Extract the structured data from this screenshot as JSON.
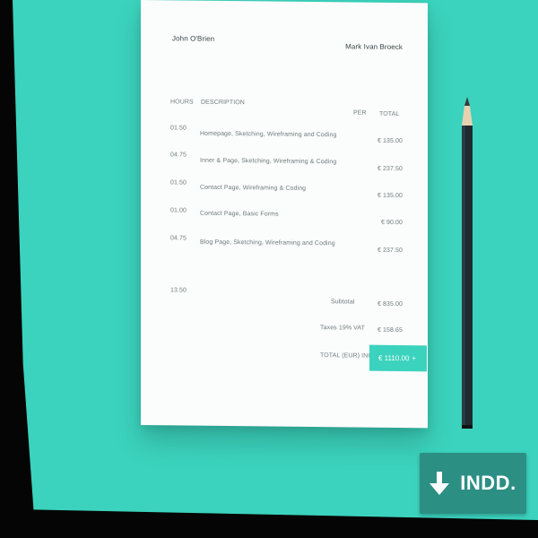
{
  "invoice": {
    "client_name": "John O'Brien",
    "sender_name": "Mark Ivan Broeck",
    "header": {
      "hours": "HOURS",
      "description": "DESCRIPTION",
      "per": "PER",
      "total": "TOTAL"
    },
    "lines": [
      {
        "hours": "01.50",
        "description": "Homepage, Sketching, Wireframing and Coding",
        "amount": "€ 135.00"
      },
      {
        "hours": "04.75",
        "description": "Inner & Page, Sketching, Wireframing & Coding",
        "amount": "€ 237.50"
      },
      {
        "hours": "01.50",
        "description": "Contact Page, Wireframing & Coding",
        "amount": "€ 135.00"
      },
      {
        "hours": "01.00",
        "description": "Contact Page, Basic Forms",
        "amount": "€ 90.00"
      },
      {
        "hours": "04.75",
        "description": "Blog Page, Sketching, Wireframing and Coding",
        "amount": "€ 237.50"
      }
    ],
    "total_hours": "13.50",
    "subtotal_label": "Subtotal",
    "subtotal_value": "€ 835.00",
    "tax_label": "Taxes 19% VAT",
    "tax_value": "€ 158.65",
    "total_label": "TOTAL (EUR) INC. VAT",
    "total_value": "€ 1110.00",
    "total_suffix": "+"
  },
  "download_button": {
    "label": "INDD.",
    "icon": "arrow-down-icon"
  },
  "colors": {
    "surface": "#3bd3bd",
    "download_bg": "#2c8f84",
    "paper": "#fbfcfc"
  }
}
